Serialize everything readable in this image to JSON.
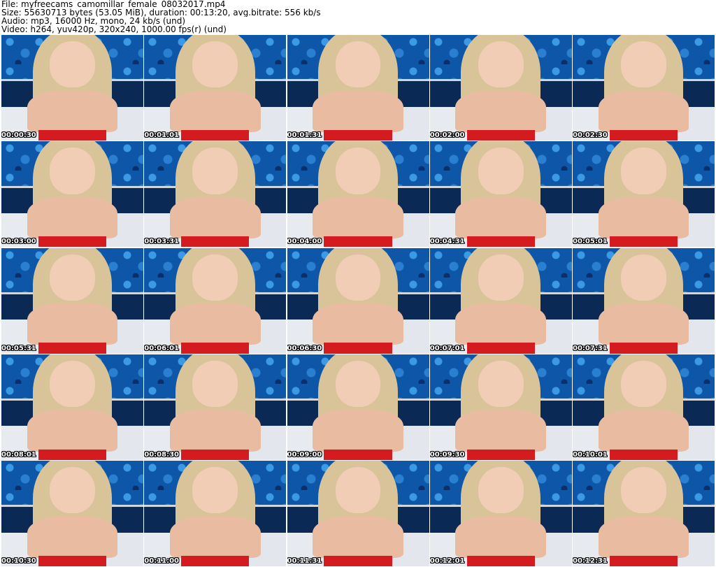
{
  "header": {
    "file_line": "File: myfreecams_camomillar_female_08032017.mp4",
    "size_line": "Size: 55630713 bytes (53.05 MiB), duration: 00:13:20, avg.bitrate: 556 kb/s",
    "audio_line": "Audio: mp3, 16000 Hz, mono, 24 kb/s (und)",
    "video_line": "Video: h264, yuv420p, 320x240, 1000.00 fps(r) (und)"
  },
  "thumbnails": [
    {
      "timestamp": "00:00:30"
    },
    {
      "timestamp": "00:01:01"
    },
    {
      "timestamp": "00:01:31"
    },
    {
      "timestamp": "00:02:00"
    },
    {
      "timestamp": "00:02:30"
    },
    {
      "timestamp": "00:03:00"
    },
    {
      "timestamp": "00:03:31"
    },
    {
      "timestamp": "00:04:00"
    },
    {
      "timestamp": "00:04:31"
    },
    {
      "timestamp": "00:05:01"
    },
    {
      "timestamp": "00:05:31"
    },
    {
      "timestamp": "00:06:01"
    },
    {
      "timestamp": "00:06:30"
    },
    {
      "timestamp": "00:07:01"
    },
    {
      "timestamp": "00:07:31"
    },
    {
      "timestamp": "00:08:01"
    },
    {
      "timestamp": "00:08:30"
    },
    {
      "timestamp": "00:09:00"
    },
    {
      "timestamp": "00:09:30"
    },
    {
      "timestamp": "00:10:01"
    },
    {
      "timestamp": "00:10:30"
    },
    {
      "timestamp": "00:11:00"
    },
    {
      "timestamp": "00:11:31"
    },
    {
      "timestamp": "00:12:01"
    },
    {
      "timestamp": "00:12:31"
    }
  ]
}
